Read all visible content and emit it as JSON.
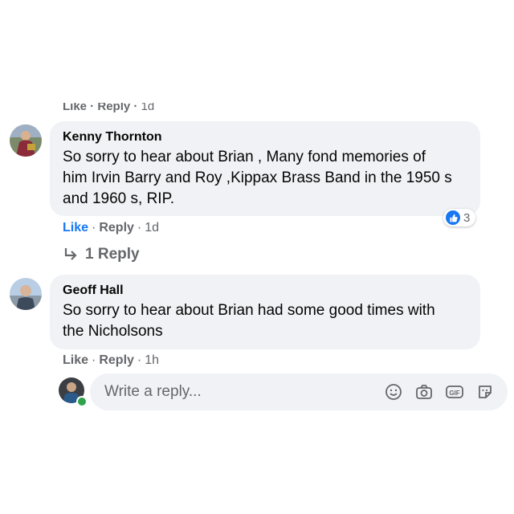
{
  "top_comment_actions": {
    "like": "Like",
    "reply": "Reply",
    "time": "1d"
  },
  "comments": [
    {
      "author": "Kenny Thornton",
      "text_lines": [
        "So sorry to hear about Brian , Many fond memories of",
        "him Irvin Barry and Roy ,Kippax Brass Band in the 1950 s",
        "and 1960 s, RIP."
      ],
      "like_label": "Like",
      "reply_label": "Reply",
      "time": "1d",
      "reaction_count": "3",
      "replies_label": "1 Reply",
      "liked": true
    },
    {
      "author": "Geoff Hall",
      "text_lines": [
        "So sorry to hear about Brian had some good times with",
        "the Nicholsons"
      ],
      "like_label": "Like",
      "reply_label": "Reply",
      "time": "1h"
    }
  ],
  "reply_box": {
    "placeholder": "Write a reply...",
    "icons": [
      "emoji-icon",
      "camera-icon",
      "gif-icon",
      "sticker-icon"
    ]
  },
  "colors": {
    "accent": "#1877f2",
    "bubble": "#f0f2f5",
    "muted": "#65676b",
    "online": "#31a24c"
  }
}
